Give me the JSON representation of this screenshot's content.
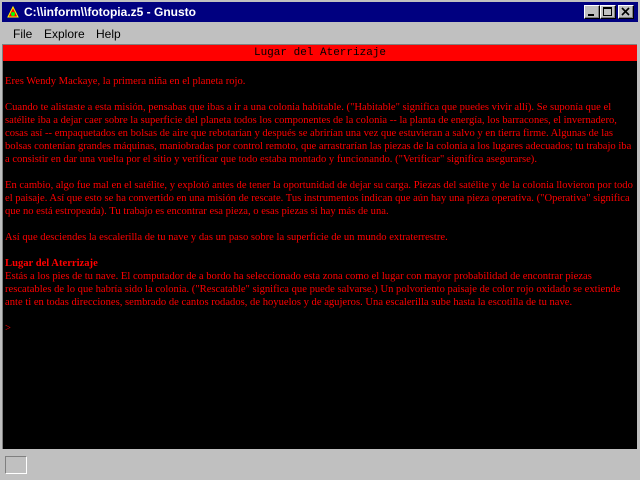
{
  "window": {
    "title": "C:\\\\inform\\\\fotopia.z5 - Gnusto"
  },
  "menu": {
    "file": "File",
    "explore": "Explore",
    "help": "Help"
  },
  "status_line": {
    "location": "Lugar del Aterrizaje"
  },
  "story": {
    "p1": "Eres Wendy Mackaye, la primera niña en el planeta rojo.",
    "p2": "Cuando te alistaste a esta misión, pensabas que ibas a ir a una colonia habitable. (\"Habitable\" significa que puedes vivir allí). Se suponía que el satélite iba a dejar caer sobre la superficie del planeta todos los componentes de la colonia -- la planta de energía, los barracones, el invernadero, cosas así -- empaquetados en bolsas de aire que rebotarían y después se abrirían una vez que estuvieran a salvo y en tierra firme. Algunas de las bolsas contenían grandes máquinas, maniobradas por control remoto, que arrastrarían las piezas de la colonia a los lugares adecuados; tu trabajo iba a consistir en dar una vuelta por el sitio y verificar que todo estaba montado y funcionando. (\"Verificar\" significa asegurarse).",
    "p3": "En cambio, algo fue mal en el satélite, y explotó antes de tener la oportunidad de dejar su carga. Piezas del satélite y de la colonia llovieron por todo el paisaje. Así que esto se ha convertido en una misión de rescate. Tus instrumentos indican que aún hay una pieza operativa. (\"Operativa\" significa que no está estropeada). Tu trabajo es encontrar esa pieza, o esas piezas si hay más de una.",
    "p4": "Así que desciendes la escalerilla de tu nave y das un paso sobre la superficie de un mundo extraterrestre.",
    "room_heading": "Lugar del Aterrizaje",
    "room_description": "Estás a los pies de tu nave. El computador de a bordo ha seleccionado esta zona como el lugar con mayor probabilidad de encontrar piezas rescatables de lo que habría sido la colonia. (\"Rescatable\" significa que puede salvarse.) Un polvoriento paisaje de color rojo oxidado se extiende ante ti en todas direcciones, sembrado de cantos rodados, de hoyuelos y de agujeros. Una escalerilla sube hasta la escotilla de tu nave.",
    "prompt": ">"
  },
  "colors": {
    "title_bar": "#000080",
    "text": "#ff0000",
    "background": "#000000",
    "status_line": "#ff0000"
  },
  "icons": {
    "app": "gnusto-app-icon",
    "minimize": "minimize-icon",
    "maximize": "maximize-icon",
    "close": "close-icon"
  }
}
